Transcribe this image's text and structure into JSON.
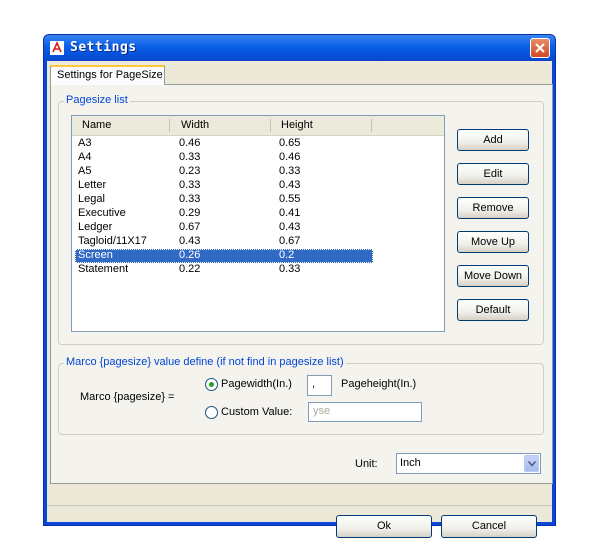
{
  "window": {
    "title": "Settings",
    "accent": "#0a46d8"
  },
  "tabs": [
    {
      "label": "Settings for PageSize",
      "active": true
    }
  ],
  "pagesize_group": {
    "legend": "Pagesize list",
    "columns": [
      "Name",
      "Width",
      "Height"
    ],
    "rows": [
      {
        "name": "A3",
        "width": "0.46",
        "height": "0.65"
      },
      {
        "name": "A4",
        "width": "0.33",
        "height": "0.46"
      },
      {
        "name": "A5",
        "width": "0.23",
        "height": "0.33"
      },
      {
        "name": "Letter",
        "width": "0.33",
        "height": "0.43"
      },
      {
        "name": "Legal",
        "width": "0.33",
        "height": "0.55"
      },
      {
        "name": "Executive",
        "width": "0.29",
        "height": "0.41"
      },
      {
        "name": "Ledger",
        "width": "0.67",
        "height": "0.43"
      },
      {
        "name": "Tagloid/11X17",
        "width": "0.43",
        "height": "0.67"
      },
      {
        "name": "Screen",
        "width": "0.26",
        "height": "0.2"
      },
      {
        "name": "Statement",
        "width": "0.22",
        "height": "0.33"
      }
    ],
    "selected_row": "Screen",
    "buttons": {
      "add": "Add",
      "edit": "Edit",
      "remove": "Remove",
      "move_up": "Move Up",
      "move_down": "Move Down",
      "default": "Default"
    }
  },
  "marco_group": {
    "legend": "Marco {pagesize} value define (if not find in pagesize list)",
    "label": "Marco {pagesize} =",
    "option_pagewidth": "Pagewidth(In.)",
    "separator_value": ",",
    "pageheight_label": "Pageheight(In.)",
    "option_custom": "Custom Value:",
    "custom_value": "yse",
    "selected_option": "pagewidth"
  },
  "unit": {
    "label": "Unit:",
    "value": "Inch"
  },
  "footer": {
    "ok": "Ok",
    "cancel": "Cancel"
  },
  "icons": {
    "app": "pdf-icon",
    "close": "close-icon",
    "dropdown": "chevron-down-icon"
  }
}
